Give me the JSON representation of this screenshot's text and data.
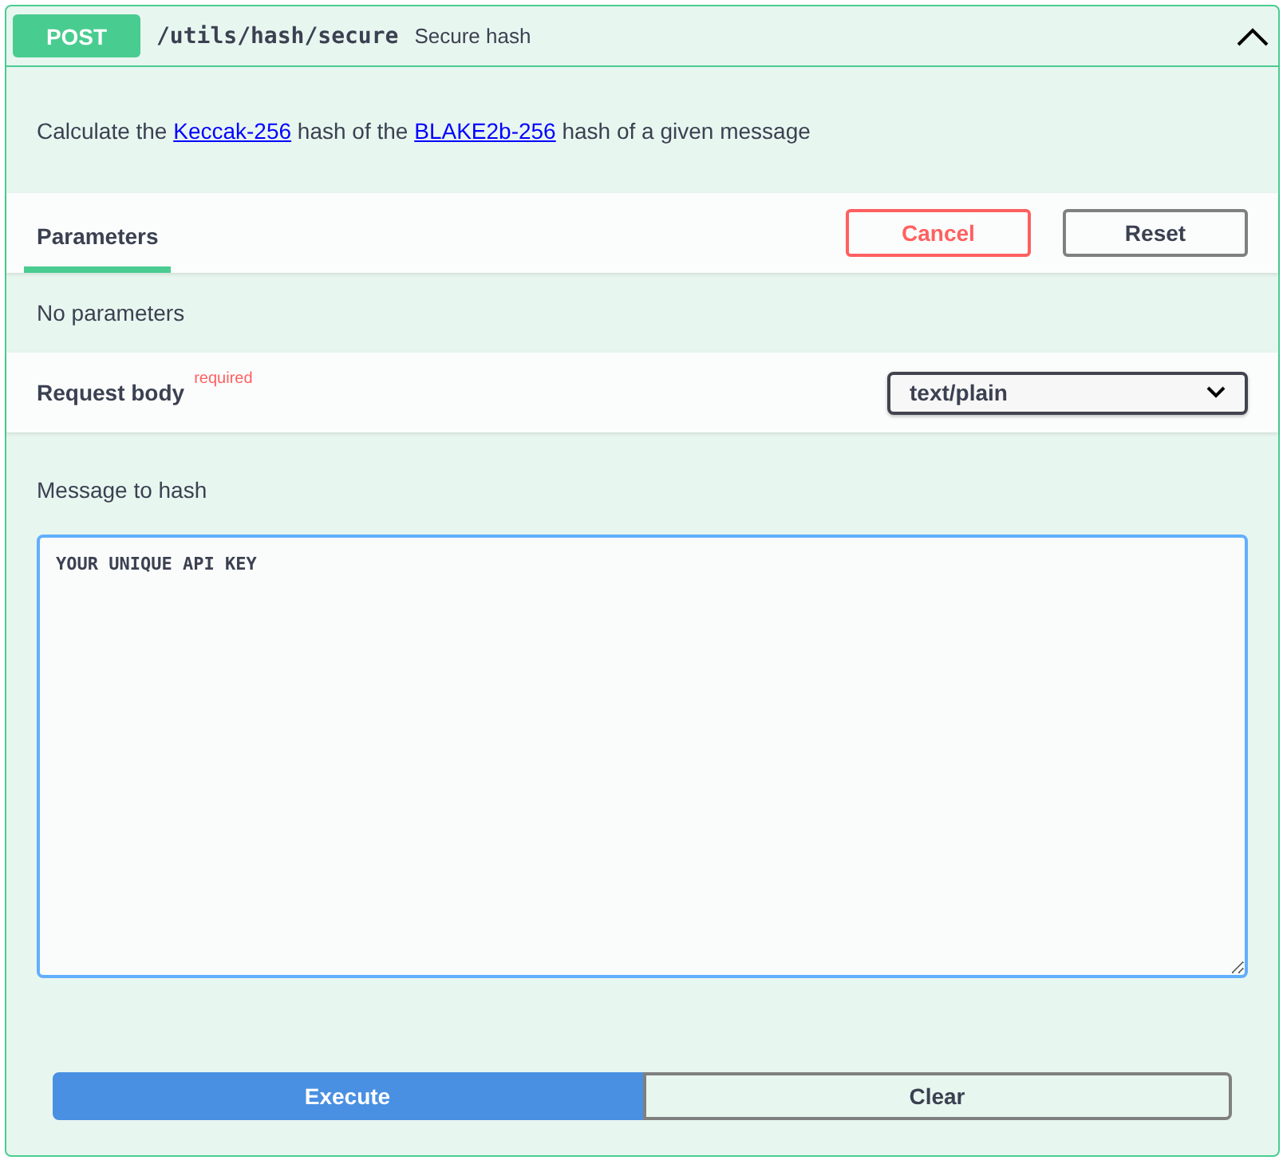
{
  "operation": {
    "method": "POST",
    "path": "/utils/hash/secure",
    "summary": "Secure hash",
    "expanded": true
  },
  "description": [
    {
      "kind": "text",
      "text": "Calculate the "
    },
    {
      "kind": "link",
      "text": "Keccak-256"
    },
    {
      "kind": "text",
      "text": " hash of the "
    },
    {
      "kind": "link",
      "text": "BLAKE2b-256"
    },
    {
      "kind": "text",
      "text": " hash of a given message"
    }
  ],
  "tabs": [
    {
      "label": "Parameters",
      "selected": true
    }
  ],
  "actions": [
    "Cancel",
    "Reset"
  ],
  "parameters_note": "No parameters",
  "request_body": {
    "label": "Request body",
    "required_label": "required",
    "content_type": "text/plain"
  },
  "message": {
    "label": "Message to hash",
    "value": "YOUR UNIQUE API KEY"
  },
  "buttons": [
    {
      "label": "Execute",
      "kind": "primary"
    },
    {
      "label": "Clear",
      "kind": "secondary"
    }
  ]
}
